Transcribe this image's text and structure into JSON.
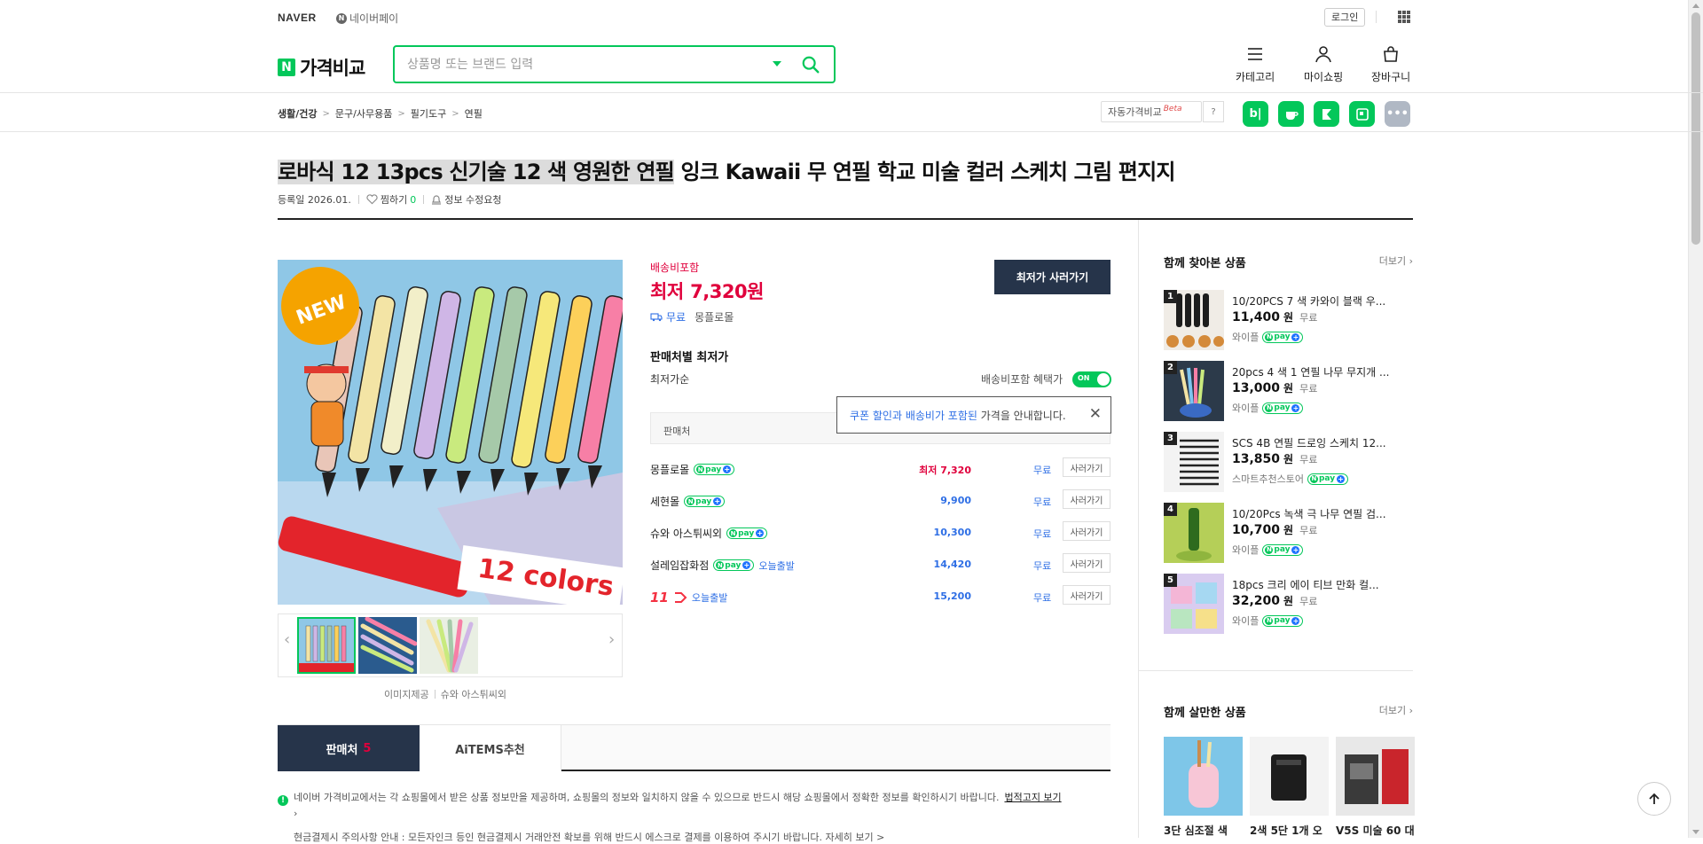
{
  "topbar": {
    "naver": "NAVER",
    "npay": "네이버페이",
    "login": "로그인"
  },
  "header": {
    "logo_n": "N",
    "logo_text": "가격비교",
    "search_placeholder": "상품명 또는 브랜드 입력",
    "nav": [
      {
        "label": "카테고리",
        "icon": "menu-icon"
      },
      {
        "label": "마이쇼핑",
        "icon": "person-icon"
      },
      {
        "label": "장바구니",
        "icon": "cart-icon"
      }
    ]
  },
  "breadcrumb": [
    "생활/건강",
    "문구/사무용품",
    "필기도구",
    "연필"
  ],
  "auto_compare": {
    "label": "자동가격비교",
    "beta": "Beta",
    "help": "?"
  },
  "share_buttons": [
    {
      "name": "blog-share-icon",
      "glyph": "b|",
      "color": "#03c75a"
    },
    {
      "name": "cafe-share-icon",
      "glyph": "☕",
      "color": "#03c75a"
    },
    {
      "name": "kakao-share-icon",
      "glyph": "K",
      "color": "#03c75a"
    },
    {
      "name": "band-share-icon",
      "glyph": "▦",
      "color": "#03c75a"
    },
    {
      "name": "more-share-icon",
      "glyph": "•••",
      "color": "#b0b8c4"
    }
  ],
  "product": {
    "title_highlight": "로바식 12 13pcs 신기술 12 색 영원한 연필",
    "title_rest": " 잉크 Kawaii 무 연필 학교 미술 컬러 스케치 그림 편지지",
    "reg_date": "등록일 2026.01.",
    "wish_label": "찜하기",
    "wish_count": "0",
    "edit_label": "정보 수정요청",
    "image_badge": "NEW",
    "image_caption": "12 colors",
    "image_provider_label": "이미지제공",
    "image_provider": "슈와 아스튀씨외"
  },
  "price": {
    "ship_included": "배송비포함",
    "lowest_prefix": "최저",
    "lowest_value": "7,320원",
    "free_ship": "무료",
    "mall": "몽플로몰",
    "buy_button": "최저가 사러가기",
    "section_title": "판매처별 최저가",
    "sort_label": "최저가순",
    "toggle_label": "배송비포함 혜택가",
    "toggle_state": "ON",
    "table_header": "판매처",
    "tooltip_blue": "쿠폰 할인과 배송비가 포함된",
    "tooltip_rest": " 가격을 안내합니다."
  },
  "sellers": [
    {
      "mall": "몽플로몰",
      "npay": true,
      "today": "",
      "price": "최저 7,320",
      "lowest": true,
      "ship": "무료",
      "btn": "사러가기"
    },
    {
      "mall": "세현몰",
      "npay": true,
      "today": "",
      "price": "9,900",
      "lowest": false,
      "ship": "무료",
      "btn": "사러가기"
    },
    {
      "mall": "슈와 아스튀씨외",
      "npay": true,
      "today": "",
      "price": "10,300",
      "lowest": false,
      "ship": "무료",
      "btn": "사러가기"
    },
    {
      "mall": "설레임잡화점",
      "npay": true,
      "today": "오늘출발",
      "price": "14,420",
      "lowest": false,
      "ship": "무료",
      "btn": "사러가기"
    },
    {
      "mall": "11번가",
      "logo": "11",
      "npay": false,
      "today": "오늘출발",
      "price": "15,200",
      "lowest": false,
      "ship": "무료",
      "btn": "사러가기"
    }
  ],
  "npay_badge": {
    "n": "N",
    "text": "pay",
    "plus": "+"
  },
  "tabs": [
    {
      "label": "판매처",
      "count": "5"
    },
    {
      "label": "AiTEMS추천"
    }
  ],
  "notice": {
    "icon": "!",
    "text": "네이버 가격비교에서는 각 쇼핑몰에서 받은 상품 정보만을 제공하며, 쇼핑몰의 정보와 일치하지 않을 수 있으므로 반드시 해당 쇼핑몰에서 정확한 정보를 확인하시기 바랍니다.",
    "link": "법적고지 보기",
    "line2": "현금결제시 주의사항 안내 : 모든자인크 등인 현금결제시 거래안전 확보를 위해 반드시 에스크로 결제를 이용하여 주시기 바랍니다.  자세히 보기 >"
  },
  "related": {
    "title": "함께 찾아본 상품",
    "more": "더보기",
    "items": [
      {
        "rank": "1",
        "name": "10/20PCS 7 색 카와이 블랙 우...",
        "price": "11,400",
        "won": "원",
        "ship": "무료",
        "mall": "와이플",
        "npay": true
      },
      {
        "rank": "2",
        "name": "20pcs 4 색 1 연필 나무 무지개 ...",
        "price": "13,000",
        "won": "원",
        "ship": "무료",
        "mall": "와이플",
        "npay": true
      },
      {
        "rank": "3",
        "name": "SCS 4B 연필 드로잉 스케치 12...",
        "price": "13,850",
        "won": "원",
        "ship": "무료",
        "mall": "스마트추천스토어",
        "npay": true
      },
      {
        "rank": "4",
        "name": "10/20Pcs 녹색 극 나무 연필 검...",
        "price": "10,700",
        "won": "원",
        "ship": "무료",
        "mall": "와이플",
        "npay": true
      },
      {
        "rank": "5",
        "name": "18pcs 크리 에이 티브 만화 컬...",
        "price": "32,200",
        "won": "원",
        "ship": "무료",
        "mall": "와이플",
        "npay": true
      }
    ]
  },
  "buy_together": {
    "title": "함께 살만한 상품",
    "more": "더보기",
    "items": [
      "3단 심조절 색",
      "2색 5단 1개 오",
      "V5S 미술 60 대"
    ]
  }
}
